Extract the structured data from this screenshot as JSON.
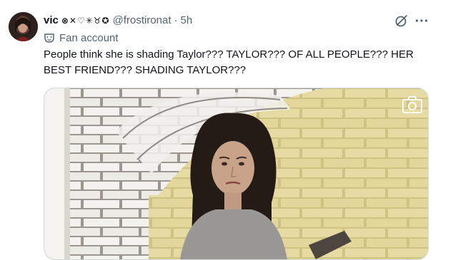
{
  "tweet": {
    "display_name": "vic",
    "display_name_emoji": "⊗✕♡✳♉✪",
    "handle": "@frostironat",
    "separator": "·",
    "time": "5h",
    "account_label": "Fan account",
    "text": "People think she is shading Taylor??? TAYLOR??? OF ALL PEOPLE??? HER BEST FRIEND??? SHADING TAYLOR???"
  },
  "icons": {
    "grok": "grok-icon",
    "more": "more-icon",
    "label": "mask-icon",
    "camera": "camera-icon"
  },
  "colors": {
    "text_primary": "#0f1419",
    "text_secondary": "#536471",
    "border": "#cfd9de"
  }
}
